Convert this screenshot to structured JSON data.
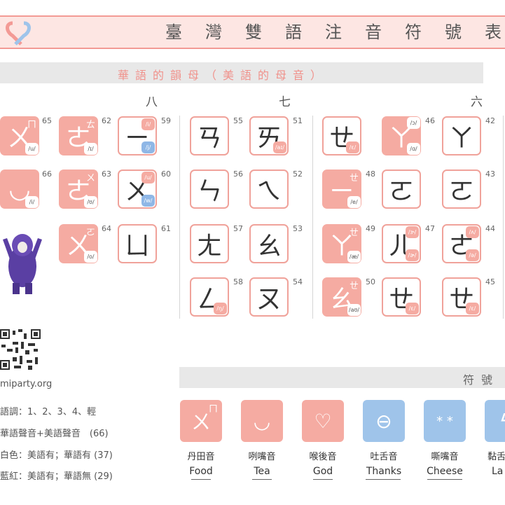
{
  "header": {
    "title_chars": [
      "臺",
      "灣",
      "雙",
      "語",
      "注",
      "音",
      "符",
      "號",
      "表"
    ],
    "subtitle": "華語的韻母（美語的母音）"
  },
  "columns": {
    "c1": "八",
    "c2": "七",
    "c3": "六"
  },
  "tiles": [
    {
      "num": "65",
      "glyph": "ㄨ",
      "ipa": "/u/",
      "tone": "ㄇ"
    },
    {
      "num": "62",
      "glyph": "ㄜ",
      "ipa": "/ɪ/",
      "tone": "ㄊ"
    },
    {
      "num": "59",
      "glyph": "ㄧ",
      "ipa": "/i/",
      "ipa2": "/j/"
    },
    {
      "num": "66",
      "glyph": "◡",
      "ipa": "/i/"
    },
    {
      "num": "63",
      "glyph": "ㄜ",
      "ipa": "/ʊ/",
      "tone": "ㄨ"
    },
    {
      "num": "60",
      "glyph": "ㄨ",
      "ipa": "/u/",
      "ipa2": "/w/"
    },
    {
      "num": "64",
      "glyph": "ㄨ",
      "ipa": "/o/",
      "tone": "ㄛ"
    },
    {
      "num": "61",
      "glyph": "ㄩ"
    },
    {
      "num": "55",
      "glyph": "ㄢ"
    },
    {
      "num": "51",
      "glyph": "ㄞ",
      "ipa": "/aɪ/"
    },
    {
      "num": "56",
      "glyph": "ㄣ"
    },
    {
      "num": "52",
      "glyph": "ㄟ"
    },
    {
      "num": "57",
      "glyph": "ㄤ"
    },
    {
      "num": "53",
      "glyph": "ㄠ"
    },
    {
      "num": "58",
      "glyph": "ㄥ",
      "ipa": "/ŋ/"
    },
    {
      "num": "54",
      "glyph": "ㄡ"
    },
    {
      "num": "",
      "glyph": "ㄝ",
      "ipa": "/ɛ/"
    },
    {
      "num": "46",
      "glyph": "ㄚ",
      "ipa": "/ɑ/",
      "tone": "/ɔ/"
    },
    {
      "num": "42",
      "glyph": "ㄚ"
    },
    {
      "num": "48",
      "glyph": "ㄧ",
      "ipa": "/e/",
      "tone": "ㄝ"
    },
    {
      "num": "",
      "glyph": "ㄛ"
    },
    {
      "num": "43",
      "glyph": "ㄛ"
    },
    {
      "num": "49",
      "glyph": "ㄚ",
      "ipa": "/æ/",
      "tone": "ㄝ"
    },
    {
      "num": "47",
      "glyph": "ㄦ",
      "ipa": "/ɚ/",
      "tone": "/ɝ/"
    },
    {
      "num": "44",
      "glyph": "ㄜ",
      "ipa": "/ə/",
      "tone": "/ʌ/"
    },
    {
      "num": "50",
      "glyph": "ㄠ",
      "ipa": "/aʊ/",
      "tone": "ㄝ"
    },
    {
      "num": "",
      "glyph": "ㄝ",
      "ipa": "/ɛ/"
    },
    {
      "num": "45",
      "glyph": "ㄝ",
      "ipa": "/ɛ/"
    }
  ],
  "site": "miparty.org",
  "legend": [
    "語調：1、2、3、4、輕",
    "華語聲音+美語聲音　(66)",
    "白色：美語有；華語有 (37)",
    "藍紅：美語有；華語無 (29)"
  ],
  "symbols_header": "符號",
  "symbols": [
    {
      "label": "丹田音",
      "word": "Food",
      "glyph": "ㄨ",
      "tone": "ㄇ",
      "color": "pink"
    },
    {
      "label": "咧嘴音",
      "word": "Tea",
      "glyph": "◡",
      "color": "pink"
    },
    {
      "label": "喉後音",
      "word": "God",
      "glyph": "♡",
      "color": "pink"
    },
    {
      "label": "吐舌音",
      "word": "Thanks",
      "glyph": "⊖",
      "color": "blue"
    },
    {
      "label": "嘶嘴音",
      "word": "Cheese",
      "glyph": "* *",
      "color": "blue"
    },
    {
      "label": "黏舌",
      "word": "La",
      "glyph": "ϟ",
      "color": "blue"
    }
  ],
  "colors": {
    "pink": "#f5aba2",
    "blue": "#9fc4ea",
    "accent": "#f39a95"
  }
}
